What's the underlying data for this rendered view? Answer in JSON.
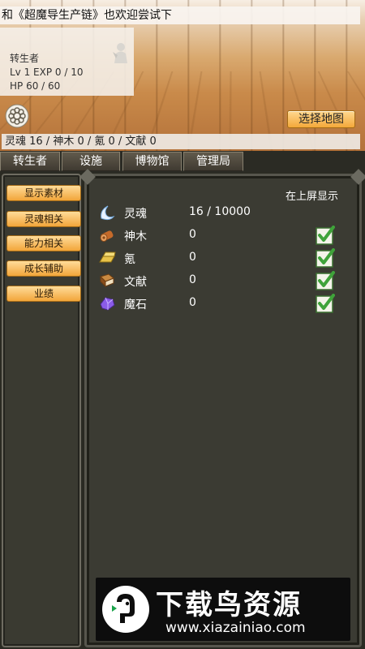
{
  "banner": {
    "text": "和《超魔导生产链》也欢迎尝试下"
  },
  "status": {
    "title": "转生者",
    "level_line": "Lv 1 EXP 0 / 10",
    "hp_line": "HP 60 / 60"
  },
  "map_button": {
    "label": "选择地图"
  },
  "resource_bar": {
    "text": "灵魂 16 / 神木 0 / 氪 0 / 文献 0"
  },
  "tabs": [
    {
      "label": "转生者"
    },
    {
      "label": "设施"
    },
    {
      "label": "博物馆"
    },
    {
      "label": "管理局"
    }
  ],
  "side_menu": [
    {
      "label": "显示素材"
    },
    {
      "label": "灵魂相关"
    },
    {
      "label": "能力相关"
    },
    {
      "label": "成长辅助"
    },
    {
      "label": "业绩"
    }
  ],
  "main": {
    "display_header": "在上屏显示",
    "resources": [
      {
        "name": "灵魂",
        "value": "16 / 10000",
        "icon": "soul-icon",
        "checked": null
      },
      {
        "name": "神木",
        "value": "0",
        "icon": "wood-log-icon",
        "checked": true
      },
      {
        "name": "氪",
        "value": "0",
        "icon": "gold-bar-icon",
        "checked": true
      },
      {
        "name": "文献",
        "value": "0",
        "icon": "book-icon",
        "checked": true
      },
      {
        "name": "魔石",
        "value": "0",
        "icon": "crystal-icon",
        "checked": true
      }
    ]
  },
  "watermark": {
    "title": "下载鸟资源",
    "url": "www.xiazainiao.com"
  },
  "colors": {
    "button_orange": "#f4a83a",
    "panel_bg": "#3b3b33",
    "check_green": "#3fa33a"
  }
}
